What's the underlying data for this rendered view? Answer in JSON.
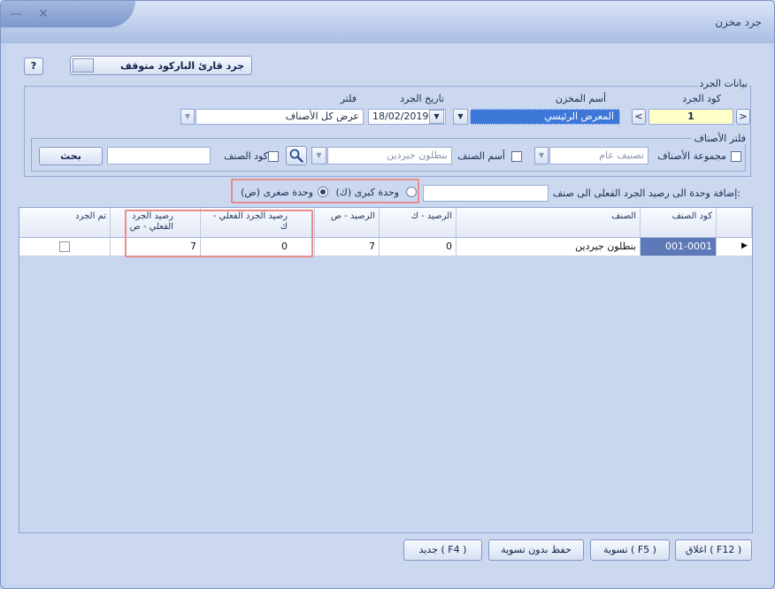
{
  "window": {
    "title": "جرد مخزن",
    "close_glyph": "✕",
    "minimize_glyph": "—"
  },
  "toolbar": {
    "help_label": "?",
    "barcode_label": "جرد قارئ الباركود متوقف"
  },
  "inventory": {
    "group_label": "بيانات الجرد",
    "code_label": "كود الجرد",
    "code_value": "1",
    "store_label": "أسم المخزن",
    "store_value": "المعرض الرئيسي",
    "date_label": "تاريخ الجرد",
    "date_value": "18/02/2019",
    "filter_label": "فلتر",
    "filter_value": "عرض كل الأصناف",
    "prev_glyph": "<",
    "next_glyph": ">"
  },
  "item_filter": {
    "group_label": "فلتر الأصناف",
    "category_label": "مجموعة الأصناف",
    "category_placeholder": "تصنيف عام",
    "item_name_label": "أسم الصنف",
    "item_name_placeholder": "بنطلون جيردين",
    "item_code_label": "كود الصنف",
    "search_label": "بحث"
  },
  "add_unit": {
    "label": "إضافة وحدة الى رصيد الجرد الفعلى الى صنف:",
    "big_unit_label": "وحدة كبرى (ك)",
    "small_unit_label": "وحدة صغرى (ص)",
    "selected": "small"
  },
  "table": {
    "columns": [
      "كود الصنف",
      "الصنف",
      "الرصيد - ك",
      "الرصيد - ص",
      "رصيد الجرد الفعلي - ك",
      "رصيد الجرد الفعلي - ص",
      "تم الجرد"
    ],
    "rows": [
      {
        "code": "001-0001",
        "name": "بنطلون جيردين",
        "bal_k": "0",
        "bal_s": "7",
        "act_k": "0",
        "act_s": "7",
        "done": false
      }
    ]
  },
  "footer": {
    "close_label": "اغلاق ( F12 )",
    "settle_label": "تسوية ( F5 )",
    "save_label": "حفظ بدون تسوية",
    "new_label": "جديد ( F4 )"
  },
  "colors": {
    "accent": "#5e79b8",
    "highlight": "#e88d8d",
    "code_field": "#ffffc8",
    "store_field": "#3d78d8"
  }
}
